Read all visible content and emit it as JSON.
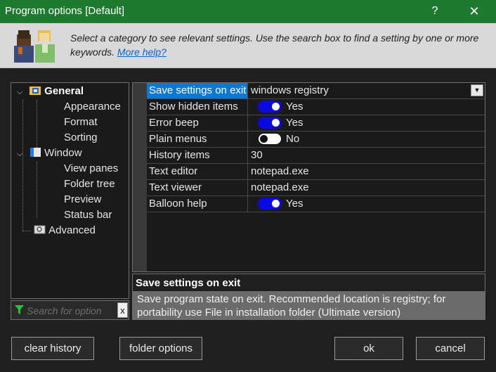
{
  "window": {
    "title": "Program options [Default]",
    "help_glyph": "?",
    "close_glyph": "✕"
  },
  "header": {
    "text": "Select a category to see relevant settings. Use the search box to find a setting by one or more keywords.",
    "link": "More help?"
  },
  "tree": {
    "items": [
      {
        "label": "General",
        "level": 0,
        "expanded": true,
        "selected": true,
        "icon": "general-folder-icon"
      },
      {
        "label": "Appearance",
        "level": 1
      },
      {
        "label": "Format",
        "level": 1
      },
      {
        "label": "Sorting",
        "level": 1
      },
      {
        "label": "Window",
        "level": 0,
        "expanded": true,
        "icon": "window-icon"
      },
      {
        "label": "View panes",
        "level": 1
      },
      {
        "label": "Folder tree",
        "level": 1
      },
      {
        "label": "Preview",
        "level": 1
      },
      {
        "label": "Status bar",
        "level": 1
      },
      {
        "label": "Advanced",
        "level": 0,
        "icon": "advanced-icon"
      }
    ]
  },
  "search": {
    "placeholder": "Search for option",
    "clear_label": "x"
  },
  "properties": [
    {
      "name": "Save settings on exit",
      "value": "windows registry",
      "kind": "dropdown",
      "selected": true
    },
    {
      "name": "Show hidden items",
      "value": "Yes",
      "kind": "toggle",
      "on": true
    },
    {
      "name": "Error beep",
      "value": "Yes",
      "kind": "toggle",
      "on": true
    },
    {
      "name": "Plain menus",
      "value": "No",
      "kind": "toggle",
      "on": false
    },
    {
      "name": "History items",
      "value": "30",
      "kind": "text"
    },
    {
      "name": "Text editor",
      "value": "notepad.exe",
      "kind": "text"
    },
    {
      "name": "Text viewer",
      "value": "notepad.exe",
      "kind": "text"
    },
    {
      "name": "Balloon help",
      "value": "Yes",
      "kind": "toggle",
      "on": true
    }
  ],
  "description": {
    "title": "Save settings on exit",
    "body": "Save program state on exit. Recommended location is registry; for portability use File in installation folder (Ultimate version)"
  },
  "buttons": {
    "clear_history": "clear history",
    "folder_options": "folder options",
    "ok": "ok",
    "cancel": "cancel"
  },
  "colors": {
    "titlebar": "#1e7a2f",
    "selection": "#0a78d7",
    "toggle_on": "#0a0ae0",
    "link": "#0b63c8"
  }
}
